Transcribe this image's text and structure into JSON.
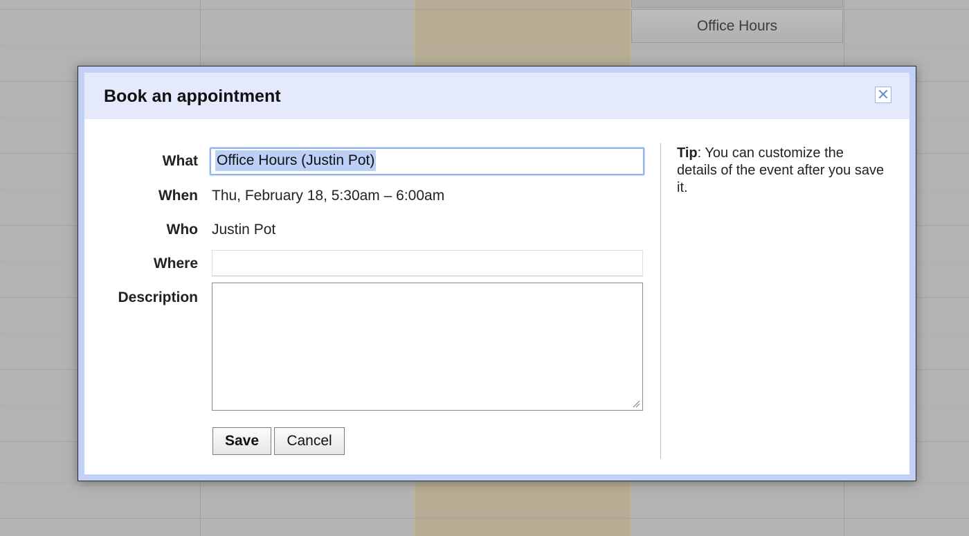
{
  "calendar": {
    "event_label": "Office Hours"
  },
  "dialog": {
    "title": "Book an appointment",
    "close_icon": "close-icon",
    "fields": {
      "what_label": "What",
      "what_value": "Office Hours (Justin Pot)",
      "when_label": "When",
      "when_value": "Thu, February 18, 5:30am – 6:00am",
      "who_label": "Who",
      "who_value": "Justin Pot",
      "where_label": "Where",
      "where_value": "",
      "description_label": "Description",
      "description_value": ""
    },
    "buttons": {
      "save": "Save",
      "cancel": "Cancel"
    },
    "tip": {
      "label": "Tip",
      "text": ": You can customize the details of the event after you save it."
    }
  },
  "colors": {
    "dialog_border": "#c3d0f7",
    "header_bg": "#e4e9fc",
    "focus": "#93b2f0",
    "selection": "#bcd0f7"
  }
}
